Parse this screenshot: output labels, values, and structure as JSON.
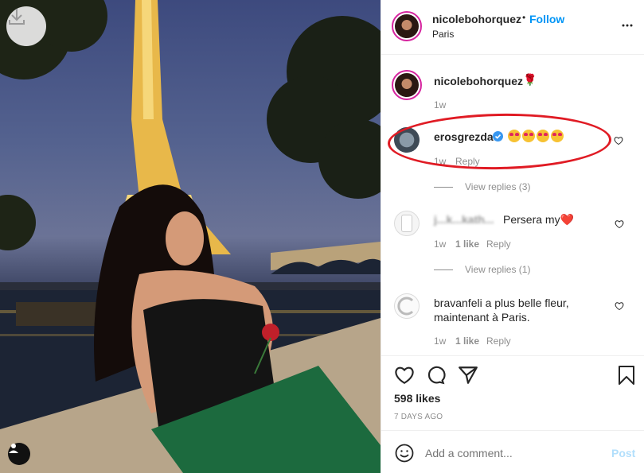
{
  "post": {
    "author": "nicolebohorquez",
    "follow_label": "Follow",
    "separator": "•",
    "location": "Paris",
    "caption_time": "1w",
    "caption_emoji": "🌹",
    "likes": "598 likes",
    "posted": "7 DAYS AGO"
  },
  "comments": [
    {
      "user": "erosgrezda",
      "text": "",
      "emojis": [
        "heart-eyes-emoji",
        "heart-eyes-emoji",
        "heart-eyes-emoji",
        "heart-eyes-emoji"
      ],
      "time": "1w",
      "likes": "",
      "reply": "Reply",
      "view_replies": "View replies (3)",
      "verified": true,
      "highlighted": true
    },
    {
      "user": "j...k...kath...",
      "text": "Persera my❤️",
      "time": "1w",
      "likes": "1 like",
      "reply": "Reply",
      "view_replies": "View replies (1)"
    },
    {
      "user": "bravanfeli...",
      "text": "...a plus belle fleur, maintenant à Paris.",
      "line1": "bravanfeli        a plus belle fleur,",
      "line2": "maintenant à Paris.",
      "time": "1w",
      "likes": "1 like",
      "reply": "Reply"
    }
  ],
  "add_comment": {
    "placeholder": "Add a comment...",
    "post_label": "Post"
  },
  "colors": {
    "follow": "#0095f6",
    "highlight": "#e01b24",
    "post_disabled": "#b2dffc"
  }
}
